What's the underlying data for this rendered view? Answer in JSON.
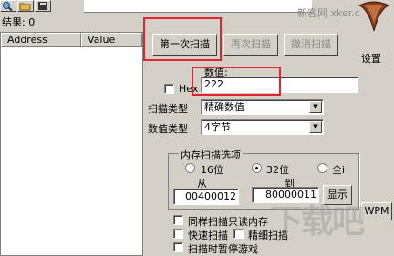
{
  "toolbar": {
    "icons": [
      "magnifier-icon",
      "open-folder-icon",
      "save-disk-icon"
    ]
  },
  "watermark_top": "新客网 xker.c",
  "results": {
    "count_label": "结果: 0",
    "columns": [
      "Address",
      "Value"
    ]
  },
  "buttons": {
    "first_scan": "第一次扫描",
    "next_scan": "再次扫描",
    "undo_scan": "撤消扫描",
    "settings": "设置",
    "show": "显示",
    "wpm": "WPM"
  },
  "value": {
    "label": "数值:",
    "hex_label": "Hex",
    "input": "222"
  },
  "scan_type": {
    "label": "扫描类型",
    "selected": "精确数值"
  },
  "value_type": {
    "label": "数值类型",
    "selected": "4字节"
  },
  "memory_options": {
    "title": "内存扫描选项",
    "radio_16": "16位",
    "radio_32": "32位",
    "radio_all": "全i",
    "from_label": "从",
    "to_label": "到",
    "from_value": "00400012",
    "to_value": "80000011"
  },
  "checkboxes": {
    "readonly": "同样扫描只读内存",
    "fast": "快速扫描",
    "precise": "精细扫描",
    "pause": "扫描时暂停游戏"
  },
  "watermark_bottom": "下载吧"
}
